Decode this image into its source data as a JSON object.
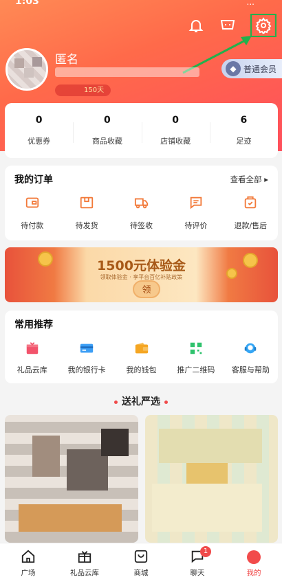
{
  "status_bar": {
    "time": "1:03",
    "signal": "..."
  },
  "header": {
    "icons": [
      "bell-icon",
      "cart-icon",
      "settings-icon"
    ],
    "username": "匿名",
    "days_badge": "150天",
    "member_label": "普通会员"
  },
  "stats": [
    {
      "value": "0",
      "label": "优惠券"
    },
    {
      "value": "0",
      "label": "商品收藏"
    },
    {
      "value": "0",
      "label": "店铺收藏"
    },
    {
      "value": "6",
      "label": "足迹"
    }
  ],
  "orders": {
    "title": "我的订单",
    "see_all": "查看全部",
    "items": [
      {
        "label": "待付款",
        "icon": "wallet-icon"
      },
      {
        "label": "待发货",
        "icon": "box-icon"
      },
      {
        "label": "待签收",
        "icon": "truck-icon"
      },
      {
        "label": "待评价",
        "icon": "comment-icon"
      },
      {
        "label": "退款/售后",
        "icon": "return-icon"
      }
    ]
  },
  "banner": {
    "title": "1500元体验金",
    "subtitle": "领取体验金 · 享平台百亿补贴政策",
    "button": "领"
  },
  "recommend": {
    "title": "常用推荐",
    "items": [
      {
        "label": "礼品云库",
        "icon": "gift-icon",
        "color": "#f2536b"
      },
      {
        "label": "我的银行卡",
        "icon": "card-icon",
        "color": "#3b9ef5"
      },
      {
        "label": "我的钱包",
        "icon": "wallet-icon",
        "color": "#f5a623"
      },
      {
        "label": "推广二维码",
        "icon": "qrcode-icon",
        "color": "#2fc26d"
      },
      {
        "label": "客服与帮助",
        "icon": "headset-icon",
        "color": "#35a6f5"
      }
    ]
  },
  "gift_section": {
    "title": "送礼严选"
  },
  "tabbar": {
    "items": [
      {
        "label": "广场"
      },
      {
        "label": "礼品云库"
      },
      {
        "label": "商城"
      },
      {
        "label": "聊天",
        "badge": "1"
      },
      {
        "label": "我的"
      }
    ]
  },
  "colors": {
    "accent": "#ff5a4f",
    "order_icon": "#f27a3a",
    "highlight": "#22b14c"
  }
}
